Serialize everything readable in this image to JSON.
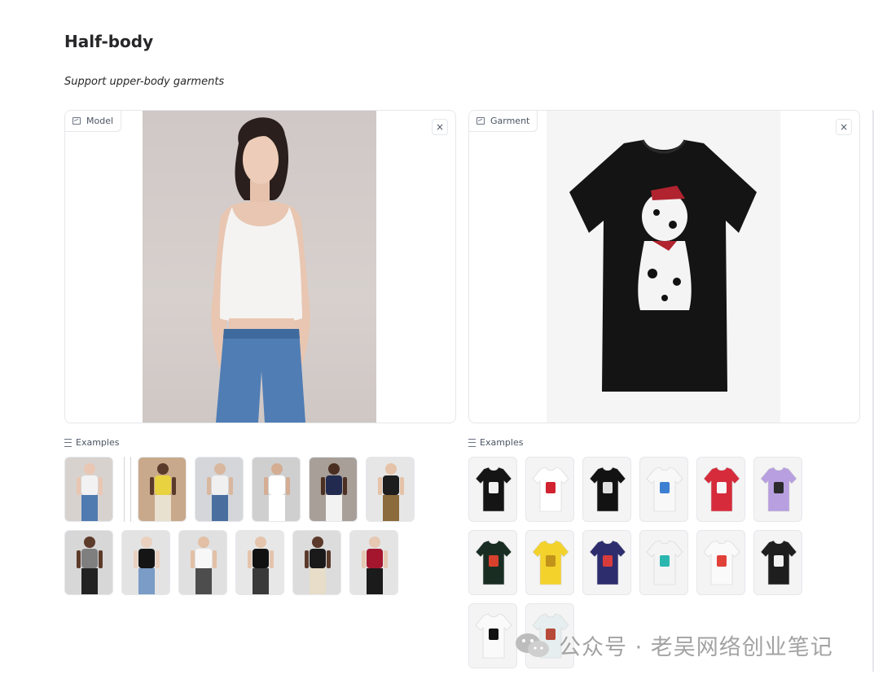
{
  "section": {
    "title": "Half-body",
    "subtitle": "Support upper-body garments"
  },
  "model_panel": {
    "label": "Model",
    "icon": "image-icon",
    "close_label": "×"
  },
  "garment_panel": {
    "label": "Garment",
    "icon": "image-icon",
    "close_label": "×"
  },
  "model_examples": {
    "label": "Examples",
    "icon": "list-icon",
    "items": [
      {
        "desc": "woman white tank jeans",
        "top": "#f2f2f2",
        "bottom": "#4f7bb0",
        "bg": "#d8d2cf",
        "skin": "#e9c7b3"
      },
      {
        "desc": "separator"
      },
      {
        "desc": "woman yellow top skirt",
        "top": "#e8d240",
        "bottom": "#e9e1cf",
        "bg": "#c9a98b",
        "skin": "#5a3a2a"
      },
      {
        "desc": "man tank jeans",
        "top": "#f0f0f0",
        "bottom": "#4a6f9f",
        "bg": "#d4d6da",
        "skin": "#d9b79e"
      },
      {
        "desc": "man white tank blank",
        "top": "#ffffff",
        "bottom": "#ffffff",
        "bg": "#cfcfcf",
        "skin": "#d4ad93"
      },
      {
        "desc": "man navy tank white pants",
        "top": "#222b4f",
        "bottom": "#f2f2f2",
        "bg": "#a89f98",
        "skin": "#4a2f22"
      },
      {
        "desc": "woman black mesh top",
        "top": "#1d1d1d",
        "bottom": "#8b6a3c",
        "bg": "#e6e6e6",
        "skin": "#e5c2a8"
      },
      {
        "desc": "woman grey tee black pants",
        "top": "#7f7f7f",
        "bottom": "#222222",
        "bg": "#d7d7d7",
        "skin": "#5d3b2a"
      },
      {
        "desc": "woman black tube jeans",
        "top": "#151515",
        "bottom": "#7a9cc6",
        "bg": "#e3e3e3",
        "skin": "#ead0bf"
      },
      {
        "desc": "woman white top print skirt",
        "top": "#f7f7f7",
        "bottom": "#4d4d4d",
        "bg": "#e0e0e0",
        "skin": "#e2bfa5"
      },
      {
        "desc": "woman black corset",
        "top": "#111111",
        "bottom": "#3a3a3a",
        "bg": "#e7e7e7",
        "skin": "#e4c4ac"
      },
      {
        "desc": "woman black halter cream pants",
        "top": "#1a1a1a",
        "bottom": "#e7ddc8",
        "bg": "#dcdcdc",
        "skin": "#5b3a2b"
      },
      {
        "desc": "woman red long sleeve",
        "top": "#a3162d",
        "bottom": "#1b1b1b",
        "bg": "#e4e4e4",
        "skin": "#e6c8b3"
      }
    ]
  },
  "garment_examples": {
    "label": "Examples",
    "icon": "list-icon",
    "items": [
      {
        "desc": "black tee dalmatian",
        "c1": "#151515",
        "c2": "#f2f2f2"
      },
      {
        "desc": "fila tee",
        "c1": "#ffffff",
        "c2": "#d0232f"
      },
      {
        "desc": "black tee photo print",
        "c1": "#121212",
        "c2": "#e0e0e0"
      },
      {
        "desc": "white tee cartoon",
        "c1": "#f8f8f8",
        "c2": "#3d7fd1"
      },
      {
        "desc": "red floral crop",
        "c1": "#d62b3b",
        "c2": "#f7f7f7"
      },
      {
        "desc": "lilac tee",
        "c1": "#b79fe0",
        "c2": "#2b2b2b"
      },
      {
        "desc": "floral long sleeve",
        "c1": "#1a2d23",
        "c2": "#d8412e"
      },
      {
        "desc": "yellow bra top",
        "c1": "#f3d22c",
        "c2": "#c2931a"
      },
      {
        "desc": "pattern bandeau",
        "c1": "#2d2d6e",
        "c2": "#d83b3b"
      },
      {
        "desc": "reebok crop",
        "c1": "#f4f4f4",
        "c2": "#2bb7b0"
      },
      {
        "desc": "white tee print",
        "c1": "#fafafa",
        "c2": "#e0423a"
      },
      {
        "desc": "striped long sleeve",
        "c1": "#1e1e1e",
        "c2": "#f2f2f2"
      },
      {
        "desc": "minnie tee",
        "c1": "#fafafa",
        "c2": "#111111"
      },
      {
        "desc": "printed dress",
        "c1": "#e7eef0",
        "c2": "#b84a3a"
      }
    ]
  },
  "watermark": {
    "text": "公众号 · 老吴网络创业笔记",
    "icon": "wechat-icon"
  },
  "colors": {
    "border": "#e5e7eb",
    "text": "#27272a",
    "muted": "#4b5563"
  }
}
